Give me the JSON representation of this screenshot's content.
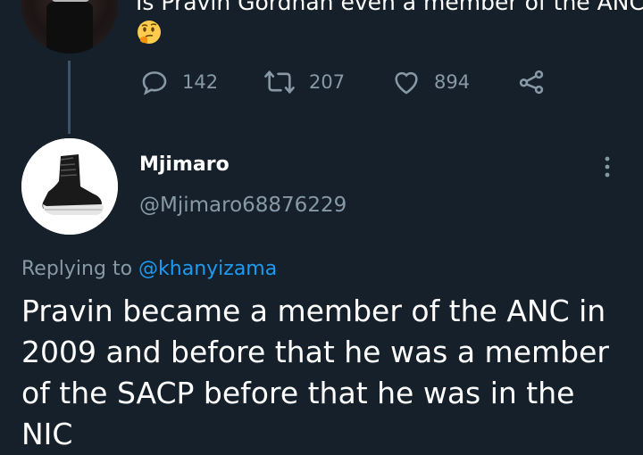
{
  "previous_tweet": {
    "text": "Is Pravin Gordhan even a member of the ANC?",
    "emoji": "🤔",
    "icons": [
      "reply-icon",
      "retweet-icon",
      "like-icon",
      "share-icon"
    ],
    "reply_count": "142",
    "retweet_count": "207",
    "like_count": "894"
  },
  "reply": {
    "display_name": "Mjimaro",
    "handle": "@Mjimaro68876229",
    "replying_prefix": "Replying to",
    "replying_to": "@khanyizama",
    "text": "Pravin became a member of the ANC in 2009 and before that he was a member of the SACP before that he was in the NIC"
  },
  "colors": {
    "background": "#15202b",
    "muted": "#8899a6",
    "link": "#1d9bf0",
    "thread_line": "#3d5466"
  }
}
